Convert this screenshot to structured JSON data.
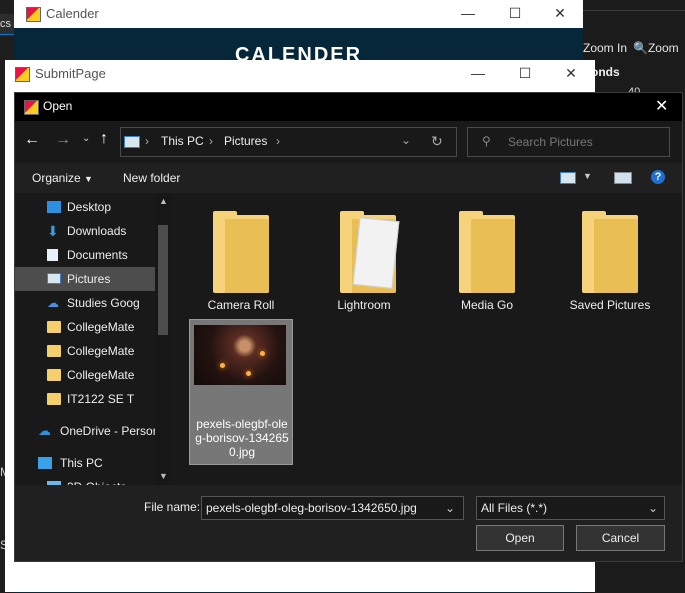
{
  "ide": {
    "tab_label": "cs",
    "zoom_in": "Zoom In",
    "zoom": "Zoom",
    "seconds_label": "onds",
    "cell_value": "40",
    "side_m": "M",
    "side_sm": "SM"
  },
  "calender_window": {
    "title": "Calender",
    "heading": "CALENDER"
  },
  "submit_window": {
    "title": "SubmitPage"
  },
  "open_dialog": {
    "title": "Open",
    "breadcrumb": [
      "This PC",
      "Pictures"
    ],
    "search_placeholder": "Search Pictures",
    "organize": "Organize",
    "new_folder": "New folder",
    "help": "?",
    "sidebar": [
      {
        "label": "Desktop",
        "icon": "desktop-icon",
        "pinned": true
      },
      {
        "label": "Downloads",
        "icon": "download-icon",
        "pinned": true
      },
      {
        "label": "Documents",
        "icon": "documents-icon",
        "pinned": true
      },
      {
        "label": "Pictures",
        "icon": "pictures-icon",
        "pinned": true,
        "selected": true
      },
      {
        "label": "Studies Goog",
        "icon": "cloud-drive-icon",
        "pinned": true
      },
      {
        "label": "CollegeMate",
        "icon": "folder-icon"
      },
      {
        "label": "CollegeMate",
        "icon": "folder-icon"
      },
      {
        "label": "CollegeMate",
        "icon": "folder-icon"
      },
      {
        "label": "IT2122 SE T",
        "icon": "folder-icon"
      },
      {
        "label": "OneDrive - Persor",
        "icon": "onedrive-icon"
      },
      {
        "label": "This PC",
        "icon": "computer-icon"
      },
      {
        "label": "3D Objects",
        "icon": "3d-objects-icon"
      }
    ],
    "items": [
      {
        "label": "Camera Roll",
        "type": "folder"
      },
      {
        "label": "Lightroom",
        "type": "folder"
      },
      {
        "label": "Media Go",
        "type": "folder"
      },
      {
        "label": "Saved Pictures",
        "type": "folder"
      },
      {
        "label": "pexels-olegbf-oleg-borisov-1342650.jpg",
        "label_lines": [
          "pexels-olegbf-ole",
          "g-borisov-134265",
          "0.jpg"
        ],
        "type": "image",
        "selected": true
      }
    ],
    "file_name_label": "File name:",
    "file_name_value": "pexels-olegbf-oleg-borisov-1342650.jpg",
    "file_type": "All Files (*.*)",
    "open_button": "Open",
    "cancel_button": "Cancel"
  }
}
